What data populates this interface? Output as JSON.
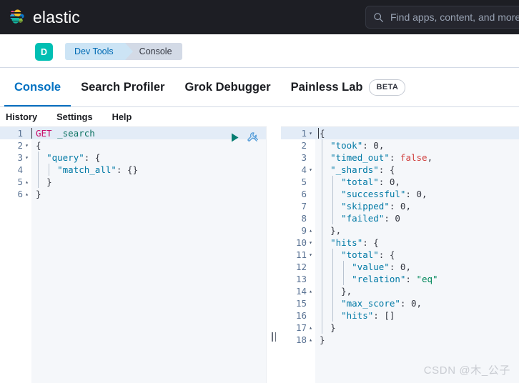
{
  "header": {
    "brand": "elastic",
    "logo_icon": "elastic-logo-icon",
    "search": {
      "icon": "search-icon",
      "placeholder": "Find apps, content, and more",
      "value": ""
    }
  },
  "breadcrumb_bar": {
    "menu_icon": "hamburger-menu-icon",
    "avatar_initial": "D",
    "crumbs": [
      {
        "label": "Dev Tools"
      },
      {
        "label": "Console"
      }
    ]
  },
  "tabs": [
    {
      "label": "Console",
      "active": true,
      "badge": ""
    },
    {
      "label": "Search Profiler",
      "active": false,
      "badge": ""
    },
    {
      "label": "Grok Debugger",
      "active": false,
      "badge": ""
    },
    {
      "label": "Painless Lab",
      "active": false,
      "badge": "BETA"
    }
  ],
  "sub_nav": [
    {
      "label": "History"
    },
    {
      "label": "Settings"
    },
    {
      "label": "Help"
    }
  ],
  "editor": {
    "actions": {
      "play": "play-icon",
      "wrench": "wrench-icon"
    },
    "lines": [
      {
        "n": "1",
        "fold": "",
        "active": true,
        "text": "GET _search"
      },
      {
        "n": "2",
        "fold": "▾",
        "active": false,
        "text": "{"
      },
      {
        "n": "3",
        "fold": "▾",
        "active": false,
        "text": "  \"query\": {"
      },
      {
        "n": "4",
        "fold": "",
        "active": false,
        "text": "    \"match_all\": {}"
      },
      {
        "n": "5",
        "fold": "▴",
        "active": false,
        "text": "  }"
      },
      {
        "n": "6",
        "fold": "▴",
        "active": false,
        "text": "}"
      }
    ]
  },
  "output": {
    "lines": [
      {
        "n": "1",
        "fold": "▾",
        "active": true,
        "text": "{"
      },
      {
        "n": "2",
        "fold": "",
        "active": false,
        "text": "  \"took\": 0,"
      },
      {
        "n": "3",
        "fold": "",
        "active": false,
        "text": "  \"timed_out\": false,"
      },
      {
        "n": "4",
        "fold": "▾",
        "active": false,
        "text": "  \"_shards\": {"
      },
      {
        "n": "5",
        "fold": "",
        "active": false,
        "text": "    \"total\": 0,"
      },
      {
        "n": "6",
        "fold": "",
        "active": false,
        "text": "    \"successful\": 0,"
      },
      {
        "n": "7",
        "fold": "",
        "active": false,
        "text": "    \"skipped\": 0,"
      },
      {
        "n": "8",
        "fold": "",
        "active": false,
        "text": "    \"failed\": 0"
      },
      {
        "n": "9",
        "fold": "▴",
        "active": false,
        "text": "  },"
      },
      {
        "n": "10",
        "fold": "▾",
        "active": false,
        "text": "  \"hits\": {"
      },
      {
        "n": "11",
        "fold": "▾",
        "active": false,
        "text": "    \"total\": {"
      },
      {
        "n": "12",
        "fold": "",
        "active": false,
        "text": "      \"value\": 0,"
      },
      {
        "n": "13",
        "fold": "",
        "active": false,
        "text": "      \"relation\": \"eq\""
      },
      {
        "n": "14",
        "fold": "▴",
        "active": false,
        "text": "    },"
      },
      {
        "n": "15",
        "fold": "",
        "active": false,
        "text": "    \"max_score\": 0,"
      },
      {
        "n": "16",
        "fold": "",
        "active": false,
        "text": "    \"hits\": []"
      },
      {
        "n": "17",
        "fold": "▴",
        "active": false,
        "text": "  }"
      },
      {
        "n": "18",
        "fold": "▴",
        "active": false,
        "text": "}"
      }
    ]
  },
  "splitter": {
    "name": "pane-splitter"
  },
  "watermark": {
    "text": "CSDN @木_公子"
  },
  "colors": {
    "header_bg": "#1d1e24",
    "accent_blue": "#0071c2",
    "avatar_teal": "#00bfb3",
    "crumb_active_bg": "#cce4f5",
    "crumb_inactive_bg": "#d3dae6",
    "editor_bg": "#f5f7fa",
    "active_line": "#e3ecf7",
    "token_method": "#c80a68",
    "token_url": "#0b7261",
    "token_key": "#0079a5",
    "token_string": "#00875a",
    "token_bool": "#d1403f"
  }
}
